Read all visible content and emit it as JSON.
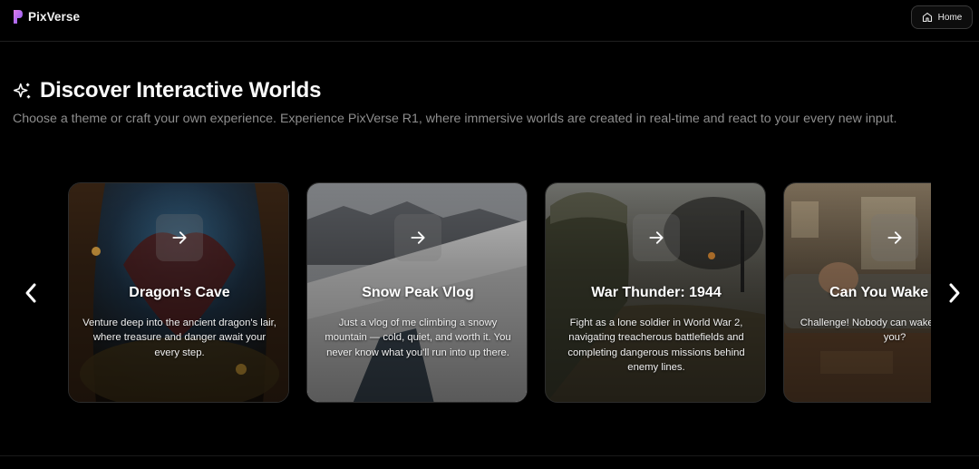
{
  "header": {
    "brand": "PixVerse",
    "home_label": "Home"
  },
  "hero": {
    "title": "Discover Interactive Worlds",
    "subtitle": "Choose a theme or craft your own experience. Experience PixVerse R1, where immersive worlds are created in real-time and react to your every new input."
  },
  "worlds": [
    {
      "title": "Dragon's Cave",
      "description": "Venture deep into the ancient dragon's lair, where treasure and danger await your every step."
    },
    {
      "title": "Snow Peak Vlog",
      "description": "Just a vlog of me climbing a snowy mountain — cold, quiet, and worth it. You never know what you'll run into up there."
    },
    {
      "title": "War Thunder: 1944",
      "description": "Fight as a lone soldier in World War 2, navigating treacherous battlefields and completing dangerous missions behind enemy lines."
    },
    {
      "title": "Can You Wake Him",
      "description": "Challenge! Nobody can wake him up, can you?"
    }
  ],
  "icons": {
    "logo": "pixverse-logo-icon",
    "home": "home-icon",
    "sparkle": "sparkle-icon",
    "card_arrow": "arrow-right-icon",
    "prev": "chevron-left-icon",
    "next": "chevron-right-icon"
  },
  "colors": {
    "background": "#000000",
    "accent_logo": "#c86bf5",
    "subtitle": "#8d8d8d"
  }
}
